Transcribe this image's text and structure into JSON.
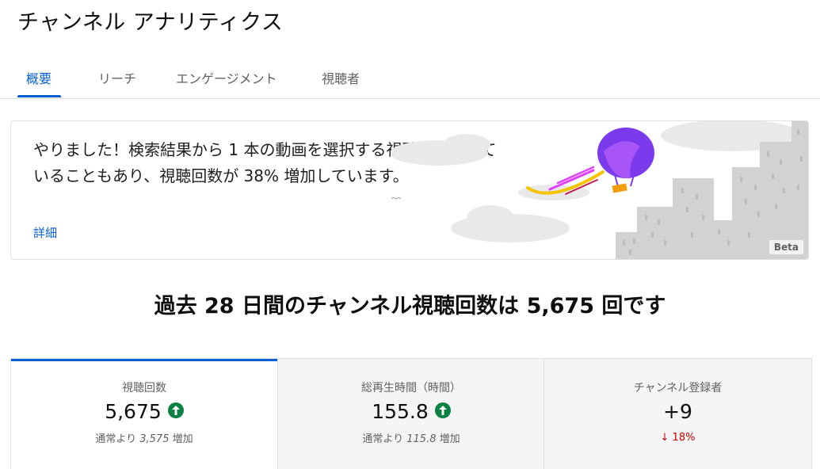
{
  "header": {
    "title": "チャンネル アナリティクス"
  },
  "tabs": [
    {
      "label": "概要",
      "active": true
    },
    {
      "label": "リーチ",
      "active": false
    },
    {
      "label": "エンゲージメント",
      "active": false
    },
    {
      "label": "視聴者",
      "active": false
    }
  ],
  "insight": {
    "text": "やりました！検索結果から 1 本の動画を選択する視聴者が増えていることもあり、視聴回数が 38% 増加しています。",
    "link": "詳細",
    "badge": "Beta"
  },
  "headline": "過去 28 日間のチャンネル視聴回数は 5,675 回です",
  "metrics": [
    {
      "label": "視聴回数",
      "value": "5,675",
      "trend": "up",
      "sub_prefix": "通常より",
      "sub_value": "3,575",
      "sub_suffix": "増加"
    },
    {
      "label": "総再生時間（時間）",
      "value": "155.8",
      "trend": "up",
      "sub_prefix": "通常より",
      "sub_value": "115.8",
      "sub_suffix": "増加"
    },
    {
      "label": "チャンネル登録者",
      "value": "+9",
      "change": "↓ 18%"
    }
  ],
  "colors": {
    "accent": "#065fd4",
    "up": "#0b8043",
    "down": "#cc0000"
  }
}
